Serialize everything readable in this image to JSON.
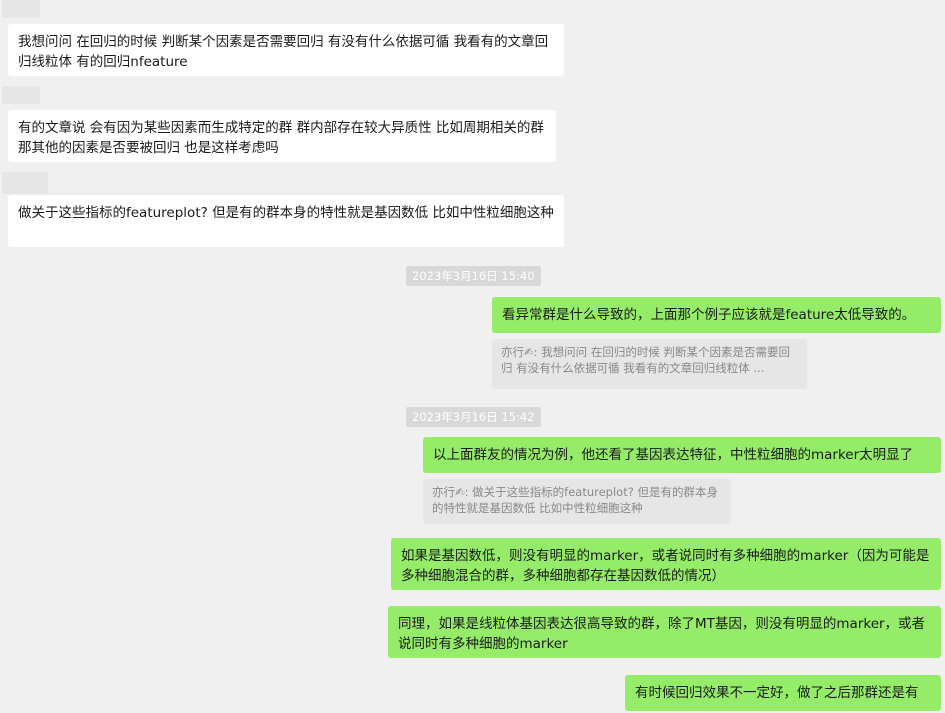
{
  "messages": [
    {
      "text": "我想问问 在回归的时候 判断某个因素是否需要回归 有没有什么依据可循 我看有的文章回归线粒体 有的回归nfeature"
    },
    {
      "text": "有的文章说 会有因为某些因素而生成特定的群 群内部存在较大异质性 比如周期相关的群 那其他的因素是否要被回归 也是这样考虑吗"
    },
    {
      "text": "做关于这些指标的featureplot? 但是有的群本身的特性就是基因数低 比如中性粒细胞这种"
    },
    {
      "time": "2023年3月16日 15:40"
    },
    {
      "text": "看异常群是什么导致的，上面那个例子应该就是feature太低导致的。"
    },
    {
      "quote": "亦行✍: 我想问问 在回归的时候 判断某个因素是否需要回归 有没有什么依据可循 我看有的文章回归线粒体 ..."
    },
    {
      "time": "2023年3月16日 15:42"
    },
    {
      "text": "以上面群友的情况为例，他还看了基因表达特征，中性粒细胞的marker太明显了"
    },
    {
      "quote": "亦行✍: 做关于这些指标的featureplot? 但是有的群本身的特性就是基因数低 比如中性粒细胞这种"
    },
    {
      "text": "如果是基因数低，则没有明显的marker，或者说同时有多种细胞的marker（因为可能是多种细胞混合的群，多种细胞都存在基因数低的情况）"
    },
    {
      "text": "同理，如果是线粒体基因表达很高导致的群，除了MT基因，则没有明显的marker，或者说同时有多种细胞的marker"
    },
    {
      "text": "有时候回归效果不一定好，做了之后那群还是有"
    }
  ]
}
